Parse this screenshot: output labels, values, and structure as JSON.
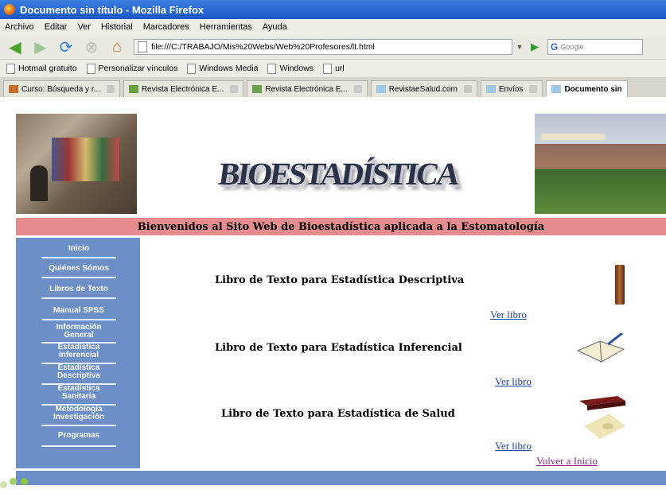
{
  "window": {
    "title": "Documento sin título - Mozilla Firefox"
  },
  "menu": [
    "Archivo",
    "Editar",
    "Ver",
    "Historial",
    "Marcadores",
    "Herramientas",
    "Ayuda"
  ],
  "address": {
    "url": "file:///C:/TRABAJO/Mis%20Webs/Web%20Profesores/lt.html"
  },
  "search": {
    "placeholder": "Google"
  },
  "bookmarks": [
    "Hotmail gratuito",
    "Personalizar vínculos",
    "Windows Media",
    "Windows",
    "url"
  ],
  "tabs": [
    {
      "label": "Curso: Búsqueda y r..."
    },
    {
      "label": "Revista Electrónica E..."
    },
    {
      "label": "Revista Electrónica E..."
    },
    {
      "label": "RevistaeSalud.com"
    },
    {
      "label": "Envíos"
    },
    {
      "label": "Documento sin"
    }
  ],
  "header": {
    "logo_text": "BIOESTADÍSTICA",
    "welcome": "Bienvenidos al Sito Web de Bioestadística aplicada a la Estomatología"
  },
  "sidebar": {
    "items": [
      {
        "label": "Inicio"
      },
      {
        "label": "Quiénes Sómos"
      },
      {
        "label": "Libros de Texto"
      },
      {
        "label": "Manual SPSS"
      },
      {
        "label": "Información General"
      },
      {
        "label": "Estadística Inferencial"
      },
      {
        "label": "Estadística Descriptiva"
      },
      {
        "label": "Estadística Sanitaria"
      },
      {
        "label": "Metodología Investigación"
      },
      {
        "label": "Programas"
      }
    ]
  },
  "books": [
    {
      "title": "Libro de Texto para Estadística Descriptiva",
      "link": "Ver libro"
    },
    {
      "title": "Libro de Texto para Estadística Inferencial",
      "link": "Ver libro"
    },
    {
      "title": "Libro de Texto para Estadística de Salud",
      "link": "Ver libro"
    }
  ],
  "back_link": "Volver a Inicio"
}
